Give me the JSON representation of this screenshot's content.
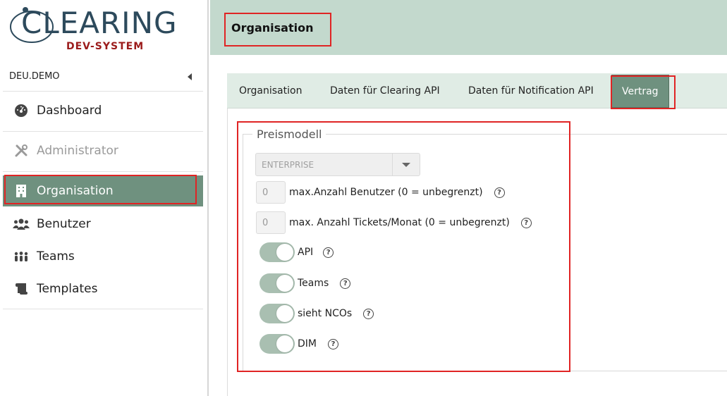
{
  "logo": {
    "text": "CLEARING",
    "subtitle": "DEV-SYSTEM"
  },
  "sidebar": {
    "org_code": "DEU.DEMO",
    "items": [
      {
        "label": "Dashboard"
      },
      {
        "label": "Administrator"
      },
      {
        "label": "Organisation"
      },
      {
        "label": "Benutzer"
      },
      {
        "label": "Teams"
      },
      {
        "label": "Templates"
      }
    ]
  },
  "header": {
    "title": "Organisation"
  },
  "tabs": [
    {
      "label": "Organisation"
    },
    {
      "label": "Daten für Clearing API"
    },
    {
      "label": "Daten für Notification API"
    },
    {
      "label": "Vertrag"
    }
  ],
  "preismodell": {
    "legend": "Preismodell",
    "plan_select": {
      "value": "ENTERPRISE"
    },
    "max_users": {
      "value": "0",
      "label": "max.Anzahl Benutzer (0 = unbegrenzt)"
    },
    "max_tickets": {
      "value": "0",
      "label": "max. Anzahl Tickets/Monat (0 = unbegrenzt)"
    },
    "toggles": [
      {
        "label": "API",
        "on": true
      },
      {
        "label": "Teams",
        "on": true
      },
      {
        "label": "sieht NCOs",
        "on": true
      },
      {
        "label": "DIM",
        "on": true
      }
    ],
    "help_glyph": "?"
  },
  "colors": {
    "accent": "#6f917f",
    "header_bg": "#c3d9cd",
    "tabs_bg": "#e0ece5",
    "highlight": "#e02424",
    "logo_blue": "#2d4a5c",
    "logo_red": "#9b1b1b"
  }
}
